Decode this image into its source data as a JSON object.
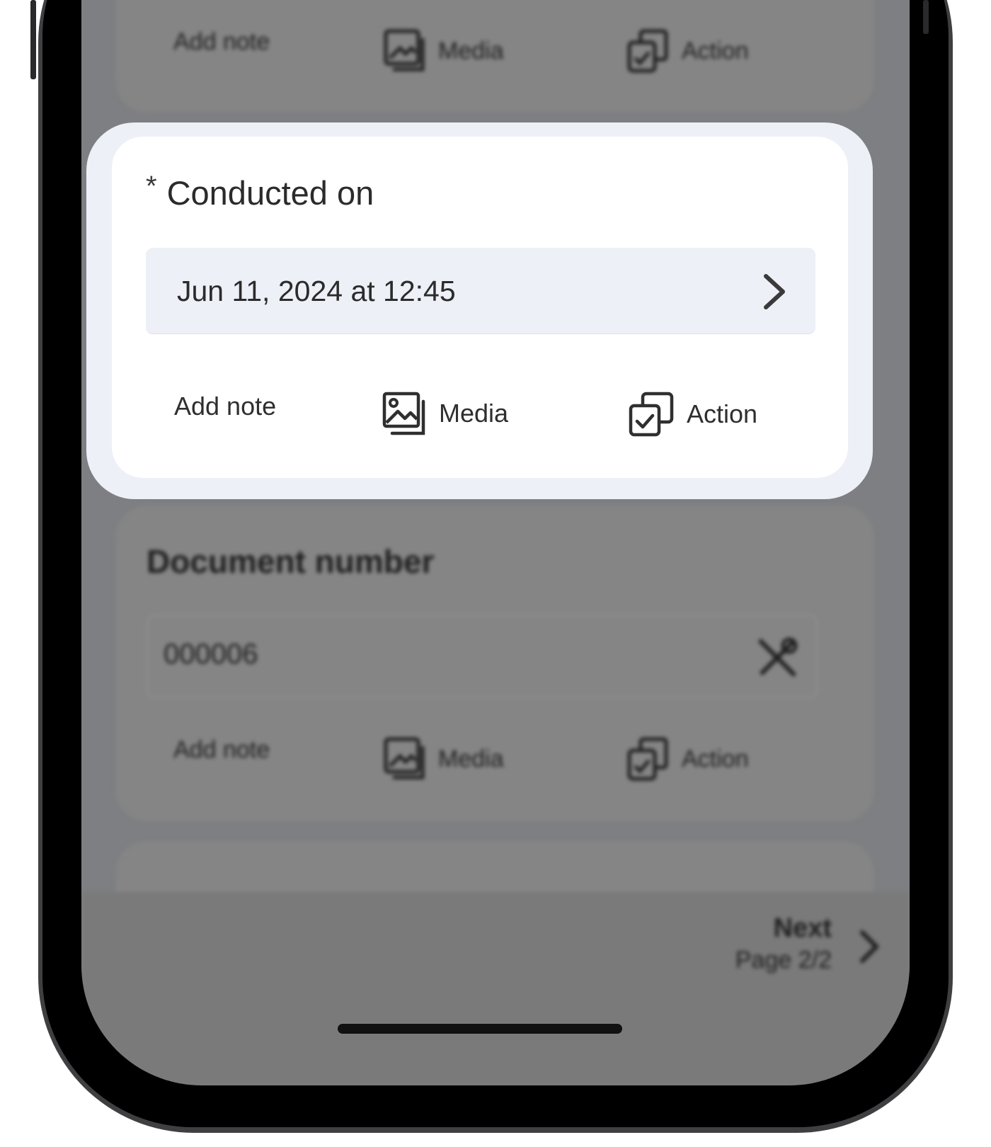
{
  "focused_field": {
    "required_marker": "*",
    "title": "Conducted on",
    "value": "Jun 11, 2024 at 12:45",
    "actions": {
      "add_note": "Add note",
      "media": "Media",
      "action": "Action"
    }
  },
  "background": {
    "prev_card_actions": {
      "add_note": "Add note",
      "media": "Media",
      "action": "Action"
    },
    "document_number": {
      "title": "Document number",
      "value": "000006",
      "actions": {
        "add_note": "Add note",
        "media": "Media",
        "action": "Action"
      }
    },
    "footer": {
      "next_label": "Next",
      "page_label": "Page 2/2"
    }
  },
  "colors": {
    "overlay": "#7d7f82",
    "card_outer": "#edf0f7",
    "card_inner": "#ffffff",
    "text": "#2b2b2b"
  },
  "icons": {
    "media": "image-gallery-icon",
    "action": "checkbox-copy-icon",
    "date_open": "chevron-right-icon",
    "document_number_tool": "tools-icon",
    "next": "chevron-right-icon"
  }
}
